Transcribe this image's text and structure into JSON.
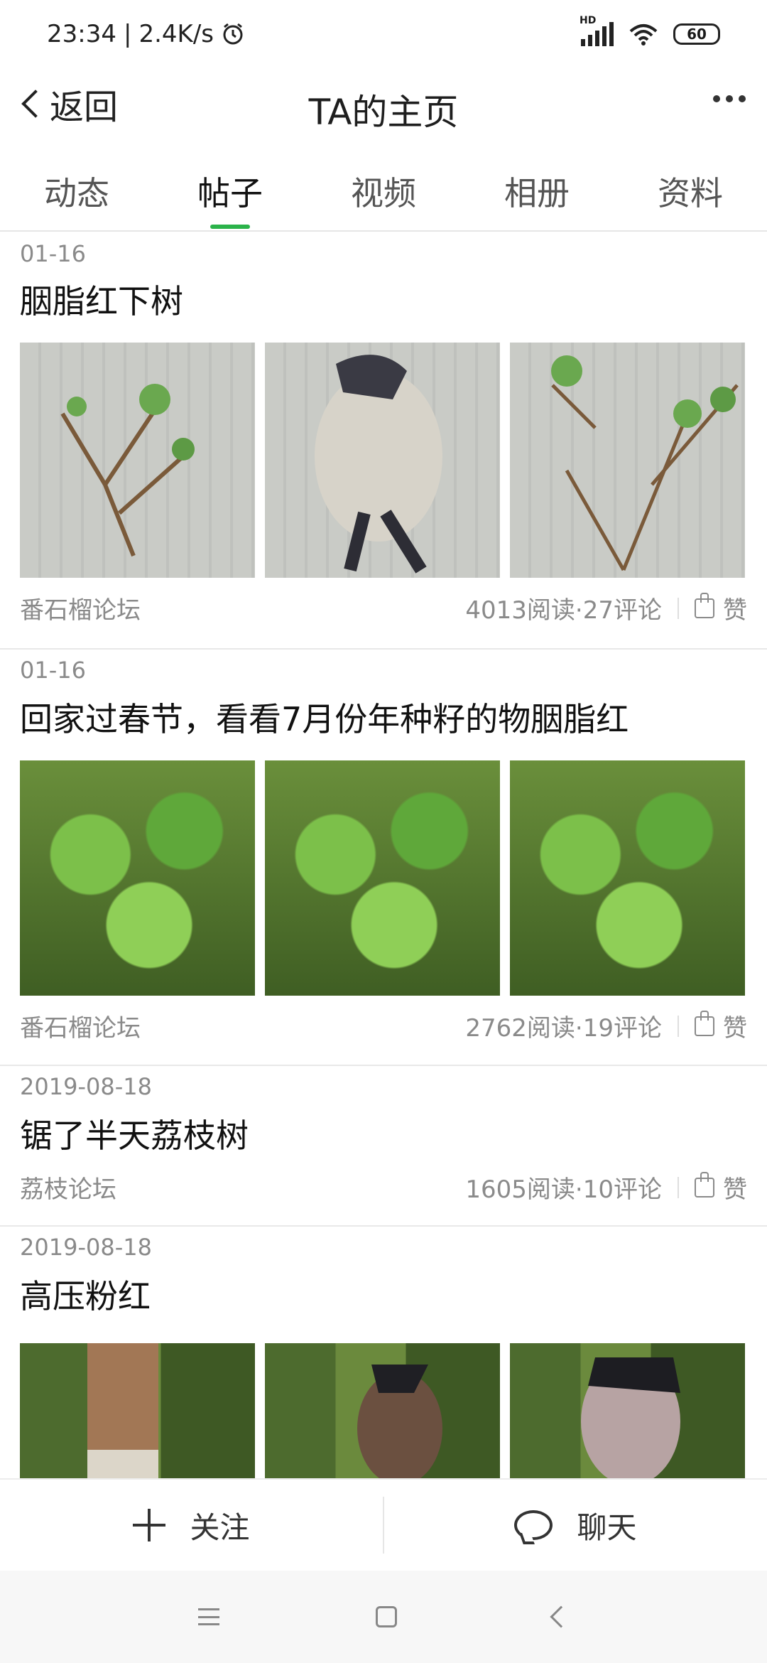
{
  "status_bar": {
    "time": "23:34",
    "net_speed": "2.4K/s",
    "battery": "60",
    "network": "HD"
  },
  "header": {
    "back_label": "返回",
    "title": "TA的主页"
  },
  "tabs": [
    {
      "label": "动态",
      "active": false
    },
    {
      "label": "帖子",
      "active": true
    },
    {
      "label": "视频",
      "active": false
    },
    {
      "label": "相册",
      "active": false
    },
    {
      "label": "资料",
      "active": false
    }
  ],
  "posts": [
    {
      "date": "01-16",
      "title": "胭脂红下树",
      "forum": "番石榴论坛",
      "stats": "4013阅读·27评论",
      "like_label": "赞"
    },
    {
      "date": "01-16",
      "title": "回家过春节，看看7月份年种籽的物胭脂红",
      "forum": "番石榴论坛",
      "stats": "2762阅读·19评论",
      "like_label": "赞"
    },
    {
      "date": "2019-08-18",
      "title": "锯了半天荔枝树",
      "forum": "荔枝论坛",
      "stats": "1605阅读·10评论",
      "like_label": "赞"
    },
    {
      "date": "2019-08-18",
      "title": "高压粉红"
    }
  ],
  "actions": {
    "follow_label": "关注",
    "chat_label": "聊天"
  },
  "colors": {
    "accent": "#2bb34a"
  }
}
